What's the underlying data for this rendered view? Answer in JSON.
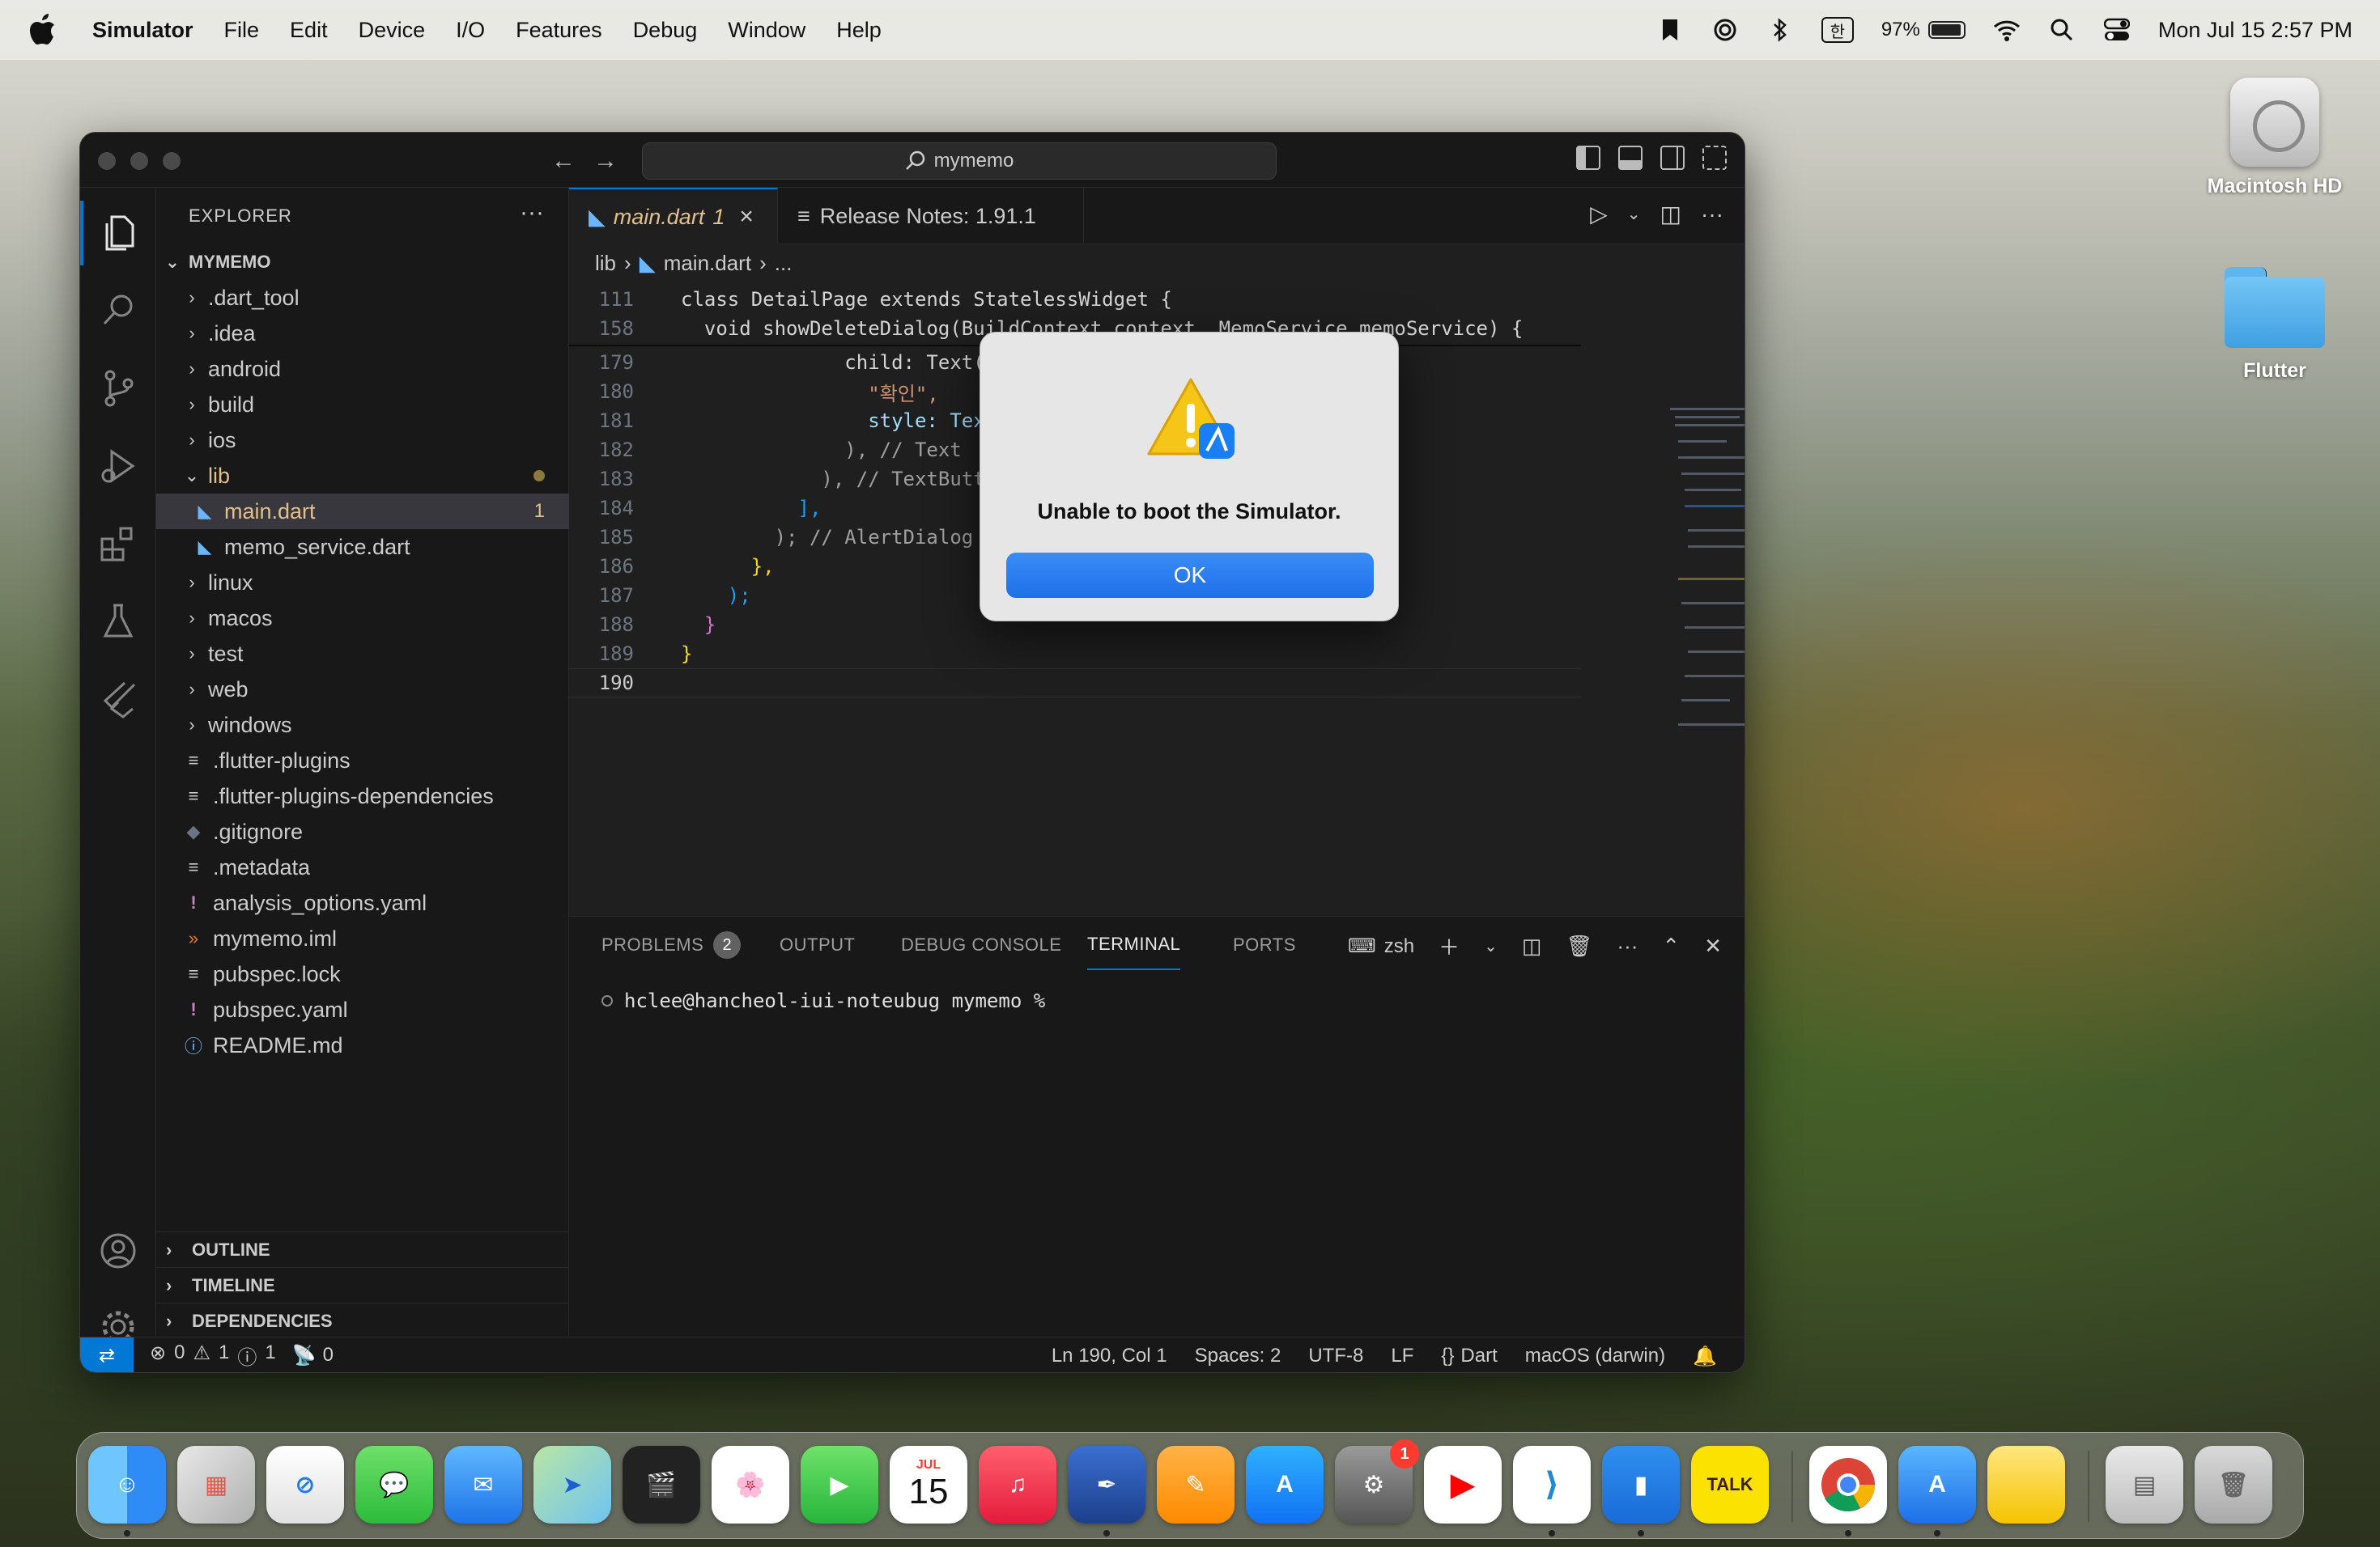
{
  "menubar": {
    "app_name": "Simulator",
    "items": [
      "File",
      "Edit",
      "Device",
      "I/O",
      "Features",
      "Debug",
      "Window",
      "Help"
    ],
    "input_indicator": "한",
    "battery": "97%",
    "clock": "Mon Jul 15  2:57 PM"
  },
  "desktop": {
    "icons": [
      {
        "label": "Macintosh HD",
        "icon": "hard-disk-icon"
      },
      {
        "label": "Flutter",
        "icon": "folder-icon"
      }
    ]
  },
  "vscode": {
    "search_label": "mymemo",
    "explorer": {
      "title": "EXPLORER",
      "root": "MYMEMO",
      "items": [
        {
          "label": ".dart_tool",
          "type": "folder"
        },
        {
          "label": ".idea",
          "type": "folder"
        },
        {
          "label": "android",
          "type": "folder"
        },
        {
          "label": "build",
          "type": "folder"
        },
        {
          "label": "ios",
          "type": "folder"
        },
        {
          "label": "lib",
          "type": "folder-open"
        },
        {
          "label": "main.dart",
          "type": "dart",
          "badge": "1"
        },
        {
          "label": "memo_service.dart",
          "type": "dart"
        },
        {
          "label": "linux",
          "type": "folder"
        },
        {
          "label": "macos",
          "type": "folder"
        },
        {
          "label": "test",
          "type": "folder"
        },
        {
          "label": "web",
          "type": "folder"
        },
        {
          "label": "windows",
          "type": "folder"
        },
        {
          "label": ".flutter-plugins",
          "type": "file"
        },
        {
          "label": ".flutter-plugins-dependencies",
          "type": "file"
        },
        {
          "label": ".gitignore",
          "type": "git"
        },
        {
          "label": ".metadata",
          "type": "file"
        },
        {
          "label": "analysis_options.yaml",
          "type": "yaml"
        },
        {
          "label": "mymemo.iml",
          "type": "rss"
        },
        {
          "label": "pubspec.lock",
          "type": "file"
        },
        {
          "label": "pubspec.yaml",
          "type": "yaml"
        },
        {
          "label": "README.md",
          "type": "info"
        }
      ],
      "sections": [
        "OUTLINE",
        "TIMELINE",
        "DEPENDENCIES"
      ]
    },
    "tabs": [
      {
        "label": "main.dart",
        "badge": "1",
        "close": "×"
      },
      {
        "label": "Release Notes: 1.91.1"
      }
    ],
    "breadcrumb": {
      "folder": "lib",
      "file": "main.dart",
      "more": "..."
    },
    "code": {
      "sticky": [
        {
          "ln": "111",
          "text": "class DetailPage extends StatelessWidget {"
        },
        {
          "ln": "158",
          "text": "  void showDeleteDialog(BuildContext context, MemoService memoService) {"
        }
      ],
      "lines": [
        {
          "ln": "179",
          "text": "              child: Text("
        },
        {
          "ln": "180",
          "text": "                \"확인\","
        },
        {
          "ln": "181",
          "text": "                style: Tex"
        },
        {
          "ln": "182",
          "text": "              ), // Text"
        },
        {
          "ln": "183",
          "text": "            ), // TextButt"
        },
        {
          "ln": "184",
          "text": "          ],"
        },
        {
          "ln": "185",
          "text": "        ); // AlertDialog"
        },
        {
          "ln": "186",
          "text": "      },"
        },
        {
          "ln": "187",
          "text": "    );"
        },
        {
          "ln": "188",
          "text": "  }"
        },
        {
          "ln": "189",
          "text": "}"
        },
        {
          "ln": "190",
          "text": ""
        }
      ]
    },
    "panel": {
      "tabs": [
        "PROBLEMS",
        "OUTPUT",
        "DEBUG CONSOLE",
        "TERMINAL",
        "PORTS"
      ],
      "problems_count": "2",
      "shell": "zsh",
      "prompt": "hclee@hancheol-iui-noteubug mymemo %"
    },
    "status": {
      "errors": "0",
      "warnings": "1",
      "infos": "1",
      "ports": "0",
      "position": "Ln 190, Col 1",
      "spaces": "Spaces: 2",
      "encoding": "UTF-8",
      "eol": "LF",
      "language": "Dart",
      "platform": "macOS (darwin)"
    }
  },
  "dialog": {
    "message": "Unable to boot the Simulator.",
    "ok": "OK"
  },
  "dock": {
    "calendar_month": "JUL",
    "calendar_day": "15",
    "settings_badge": "1",
    "talk_label": "TALK"
  }
}
